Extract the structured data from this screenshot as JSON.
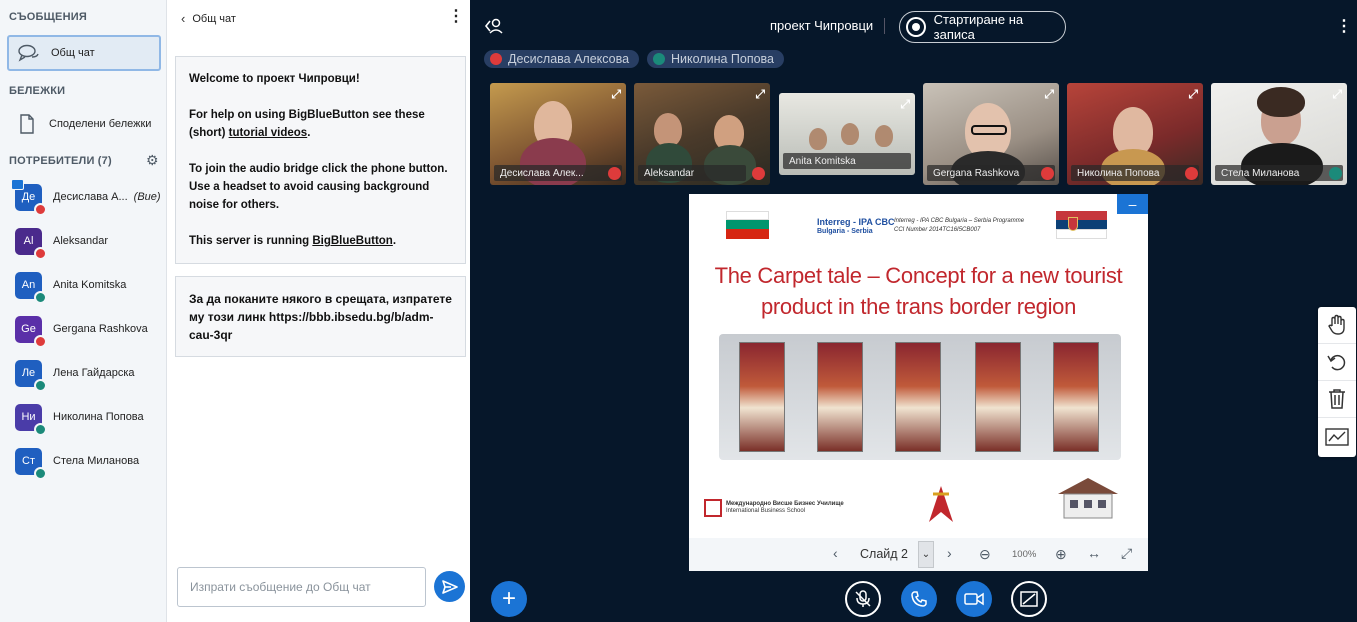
{
  "sidebar": {
    "messages_title": "СЪОБЩЕНИЯ",
    "public_chat": "Общ чат",
    "notes_title": "БЕЛЕЖКИ",
    "shared_notes": "Споделени бележки",
    "users_title": "ПОТРЕБИТЕЛИ (7)",
    "users": [
      {
        "initials": "Де",
        "name": "Десислава А...",
        "you": "(Вие)",
        "color": "#1f5fc0",
        "status": "muted",
        "presenter": true
      },
      {
        "initials": "Al",
        "name": "Aleksandar",
        "you": "",
        "color": "#4a2a8c",
        "status": "muted",
        "presenter": false
      },
      {
        "initials": "An",
        "name": "Anita Komitska",
        "you": "",
        "color": "#1f5fc0",
        "status": "listen",
        "presenter": false
      },
      {
        "initials": "Ge",
        "name": "Gergana Rashkova",
        "you": "",
        "color": "#5a2fa8",
        "status": "muted",
        "presenter": false
      },
      {
        "initials": "Ле",
        "name": "Лена Гайдарска",
        "you": "",
        "color": "#1f5fc0",
        "status": "listen",
        "presenter": false
      },
      {
        "initials": "Ни",
        "name": "Николина Попова",
        "you": "",
        "color": "#4a3ca8",
        "status": "listen",
        "presenter": false
      },
      {
        "initials": "Ст",
        "name": "Стела Миланова",
        "you": "",
        "color": "#1f5fc0",
        "status": "listen",
        "presenter": false
      }
    ]
  },
  "chat": {
    "header": "Общ чат",
    "welcome_prefix": "Welcome to ",
    "welcome_room": "проект Чипровци",
    "welcome_suffix": "!",
    "help_prefix": "For help on using BigBlueButton see these (short) ",
    "help_link": "tutorial videos",
    "help_suffix": ".",
    "audio_text": "To join the audio bridge click the phone button. Use a headset to avoid causing background noise for others.",
    "server_prefix": "This server is running ",
    "server_link": "BigBlueButton",
    "server_suffix": ".",
    "invite_text": "За да поканите някого в срещата, изпратете му този линк https://bbb.ibsedu.bg/b/adm-cau-3qr",
    "input_placeholder": "Изпрати съобщение до Общ чат"
  },
  "meeting": {
    "title": "проект Чипровци",
    "record_label": "Стартиране на записа",
    "talkers": [
      "Десислава Алексова",
      "Николина Попова"
    ]
  },
  "videos": [
    {
      "name": "Десислава Алек...",
      "status": "muted"
    },
    {
      "name": "Aleksandar",
      "status": "muted"
    },
    {
      "name": "Anita Komitska",
      "status": "none"
    },
    {
      "name": "Gergana Rashkova",
      "status": "muted"
    },
    {
      "name": "Николина Попова",
      "status": "muted"
    },
    {
      "name": "Стела Миланова",
      "status": "listen"
    }
  ],
  "presentation": {
    "interreg_line1": "Interreg - IPA CBC",
    "interreg_line2": "Bulgaria - Serbia",
    "programme_line1": "Interreg - IPA CBC Bulgaria – Serbia Programme",
    "programme_line2": "CCI Number 2014TC16I5CB007",
    "title": "The Carpet tale – Concept for a new tourist product in the trans border region",
    "ibs_line1": "Международно Висше Бизнес Училище",
    "ibs_line2": "International Business School",
    "slide_label": "Слайд 2",
    "zoom": "100%"
  },
  "colors": {
    "accent": "#1b74d5",
    "dark_bg": "#06172a",
    "muted": "#de3b3b",
    "listen": "#1b8a7a"
  }
}
